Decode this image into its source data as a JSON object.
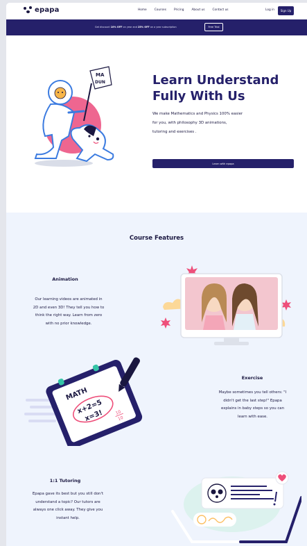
{
  "nav": {
    "logo_text": "epapa",
    "links": [
      "Home",
      "Courses",
      "Pricing",
      "About us",
      "Contact us"
    ],
    "login_label": "Log in",
    "signup_label": "Sign Up"
  },
  "promo": {
    "text_prefix": "Get discount ",
    "text_bold1": "10% OFF",
    "text_mid": " on year and ",
    "text_bold2": "25% OFF",
    "text_suffix": " on a year subscription",
    "trial_label": "Free Trial"
  },
  "hero": {
    "title": "Learn Understand Fully With Us",
    "description_lines": [
      "We make Mathematics and Physics 100% easier",
      "for you, with philosophy  3D animations,",
      "tutoring and exercises ."
    ],
    "cta_label": "Learn with epapa",
    "flag_text": "MA DUN"
  },
  "features": {
    "title": "Course Features",
    "items": [
      {
        "heading": "Animation",
        "lines": [
          "Our learning videos are animated in",
          "2D and even 3D! They tell you how to",
          "think the right way. Learn from zero",
          "with no prior knowledge."
        ]
      },
      {
        "heading": "Exercise",
        "lines": [
          "Maybe sometimes you tell others: \"I",
          "didn't get the last step!\" Epapa",
          "explains in baby steps so you can",
          "learn with ease."
        ]
      },
      {
        "heading": "1:1 Tutoring",
        "lines": [
          "Epapa gave its best but you still don't",
          "understand a topic? Our tutors are",
          "always one click away. They give you",
          "instant help."
        ]
      }
    ],
    "math_board": {
      "title": "MATH",
      "eq1": "x+2=5",
      "eq2": "x=3!",
      "fraction_num": "10",
      "fraction_den": "10"
    }
  },
  "colors": {
    "brand_navy": "#25206a",
    "feature_bg": "#eff4fd",
    "accent_pink": "#ee4f7a",
    "accent_teal": "#34c4a6"
  }
}
